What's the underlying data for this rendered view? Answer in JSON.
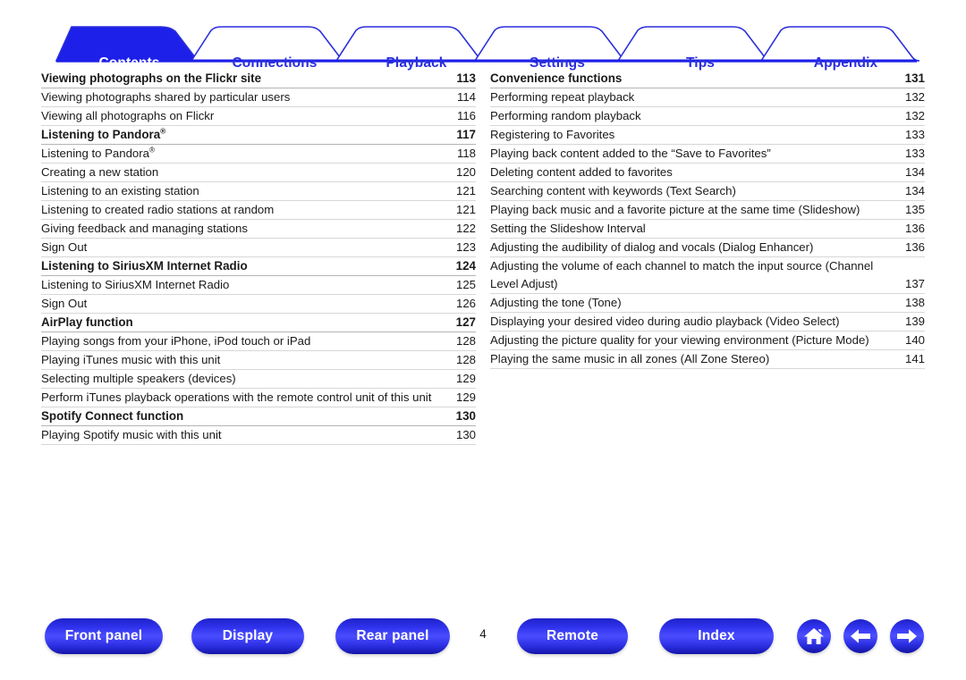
{
  "tabs": [
    {
      "label": "Contents",
      "active": true
    },
    {
      "label": "Connections",
      "active": false
    },
    {
      "label": "Playback",
      "active": false
    },
    {
      "label": "Settings",
      "active": false
    },
    {
      "label": "Tips",
      "active": false
    },
    {
      "label": "Appendix",
      "active": false
    }
  ],
  "colors": {
    "tab_blue": "#2b2fdb",
    "tab_active_fill": "#1d20e8",
    "tab_active_text": "#ffffff",
    "button_blue": "#2d30e8",
    "rule_light": "#d7d7d7",
    "rule_heading": "#b4b4b4",
    "text": "#1a1a1a"
  },
  "toc": {
    "left_column": [
      {
        "title": "Viewing photographs on the Flickr site",
        "page": "113",
        "level": "heading"
      },
      {
        "title": "Viewing photographs shared by particular users",
        "page": "114",
        "level": "item"
      },
      {
        "title": "Viewing all photographs on Flickr",
        "page": "116",
        "level": "item"
      },
      {
        "title": "Listening to Pandora®",
        "page": "117",
        "level": "heading",
        "reg": true
      },
      {
        "title": "Listening to Pandora®",
        "page": "118",
        "level": "item",
        "reg": true
      },
      {
        "title": "Creating a new station",
        "page": "120",
        "level": "item"
      },
      {
        "title": "Listening to an existing station",
        "page": "121",
        "level": "item"
      },
      {
        "title": "Listening to created radio stations at random",
        "page": "121",
        "level": "item"
      },
      {
        "title": "Giving feedback and managing stations",
        "page": "122",
        "level": "item"
      },
      {
        "title": "Sign Out",
        "page": "123",
        "level": "item"
      },
      {
        "title": "Listening to SiriusXM Internet Radio",
        "page": "124",
        "level": "heading"
      },
      {
        "title": "Listening to SiriusXM Internet Radio",
        "page": "125",
        "level": "item"
      },
      {
        "title": "Sign Out",
        "page": "126",
        "level": "item"
      },
      {
        "title": "AirPlay function",
        "page": "127",
        "level": "heading"
      },
      {
        "title": "Playing songs from your iPhone, iPod touch or iPad",
        "page": "128",
        "level": "item"
      },
      {
        "title": "Playing iTunes music with this unit",
        "page": "128",
        "level": "item"
      },
      {
        "title": "Selecting multiple speakers (devices)",
        "page": "129",
        "level": "item"
      },
      {
        "title": "Perform iTunes playback operations with the remote control unit of this unit",
        "page": "129",
        "level": "item"
      },
      {
        "title": "Spotify Connect function",
        "page": "130",
        "level": "heading"
      },
      {
        "title": "Playing Spotify music with this unit",
        "page": "130",
        "level": "item"
      }
    ],
    "right_column": [
      {
        "title": "Convenience functions",
        "page": "131",
        "level": "heading"
      },
      {
        "title": "Performing repeat playback",
        "page": "132",
        "level": "item"
      },
      {
        "title": "Performing random playback",
        "page": "132",
        "level": "item"
      },
      {
        "title": "Registering to Favorites",
        "page": "133",
        "level": "item"
      },
      {
        "title": "Playing back content added to the “Save to Favorites”",
        "page": "133",
        "level": "item"
      },
      {
        "title": "Deleting content added to favorites",
        "page": "134",
        "level": "item"
      },
      {
        "title": "Searching content with keywords (Text Search)",
        "page": "134",
        "level": "item"
      },
      {
        "title": "Playing back music and a favorite picture at the same time (Slideshow)",
        "page": "135",
        "level": "item"
      },
      {
        "title": "Setting the Slideshow Interval",
        "page": "136",
        "level": "item"
      },
      {
        "title": "Adjusting the audibility of dialog and vocals (Dialog Enhancer)",
        "page": "136",
        "level": "item"
      },
      {
        "title": "Adjusting the volume of each channel to match the input source (Channel Level Adjust)",
        "page": "137",
        "level": "item"
      },
      {
        "title": "Adjusting the tone (Tone)",
        "page": "138",
        "level": "item"
      },
      {
        "title": "Displaying your desired video during audio playback (Video Select)",
        "page": "139",
        "level": "item"
      },
      {
        "title": "Adjusting the picture quality for your viewing environment (Picture Mode)",
        "page": "140",
        "level": "item"
      },
      {
        "title": "Playing the same music in all zones (All Zone Stereo)",
        "page": "141",
        "level": "item"
      }
    ]
  },
  "bottom_nav": {
    "buttons": [
      {
        "label": "Front panel"
      },
      {
        "label": "Display"
      },
      {
        "label": "Rear panel"
      },
      {
        "label": "Remote"
      },
      {
        "label": "Index"
      }
    ],
    "page_number": "4",
    "icons": [
      {
        "name": "home-icon"
      },
      {
        "name": "arrow-left-icon"
      },
      {
        "name": "arrow-right-icon"
      }
    ]
  }
}
